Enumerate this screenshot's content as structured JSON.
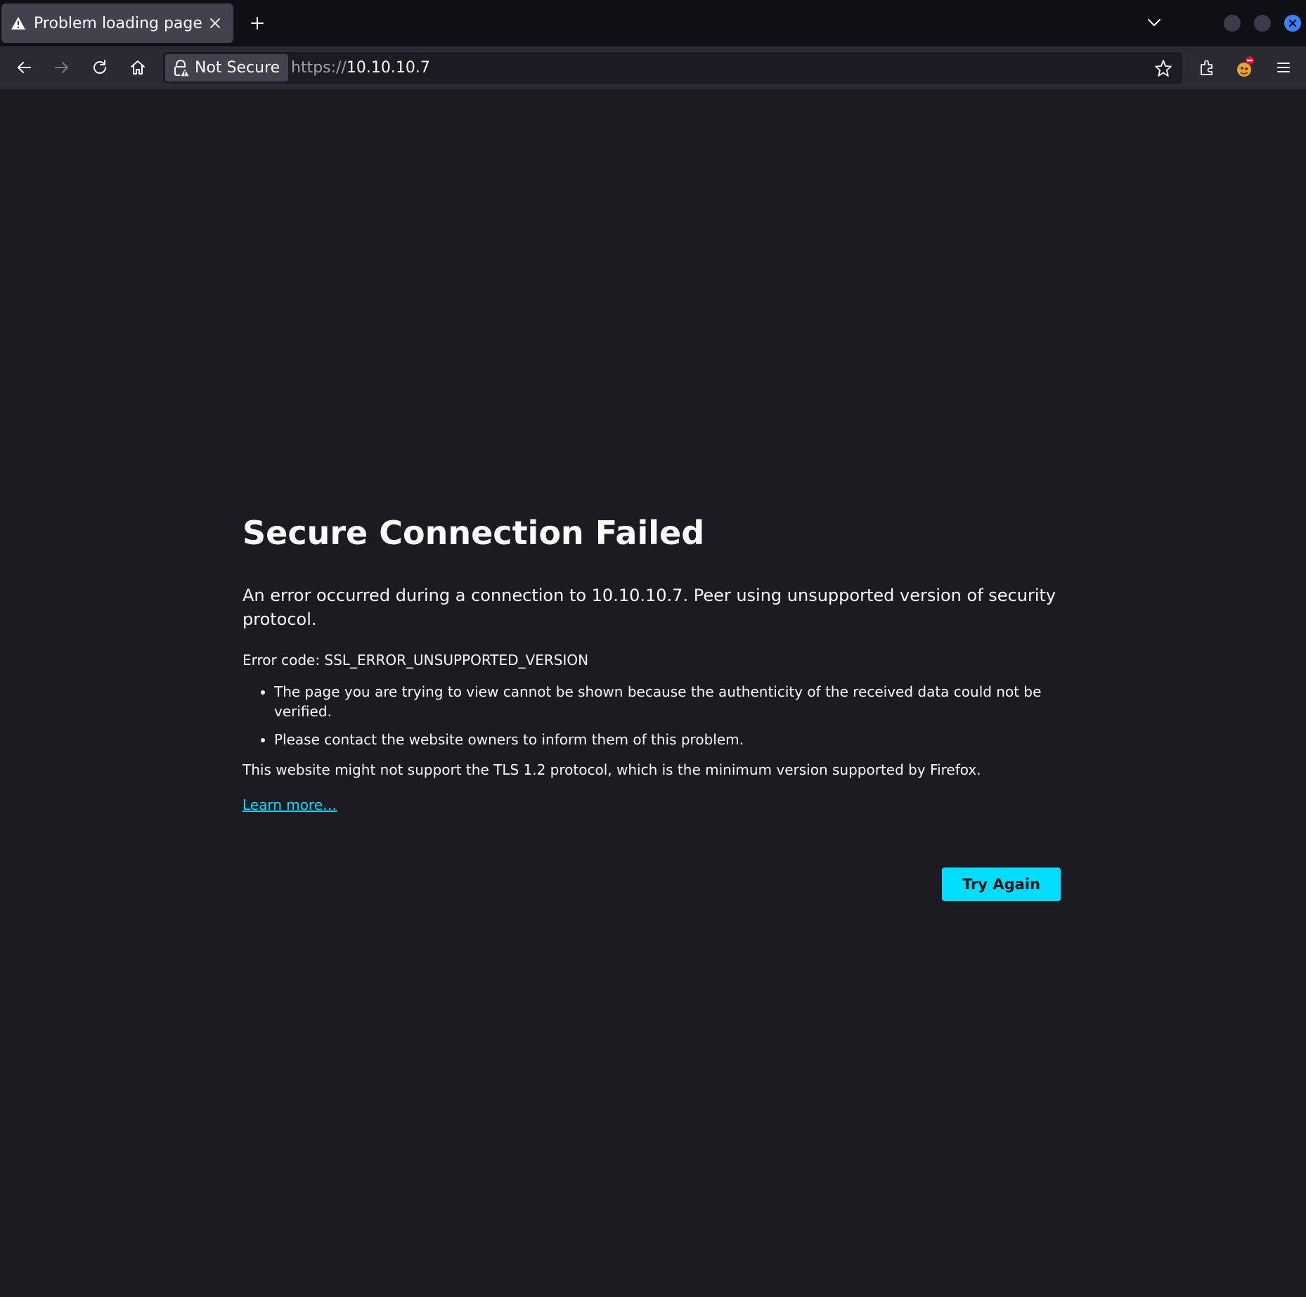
{
  "tab": {
    "title": "Problem loading page",
    "icon": "warning-icon"
  },
  "urlbar": {
    "identity_label": "Not Secure",
    "url_scheme": "https://",
    "url_host": "10.10.10.7"
  },
  "error": {
    "title": "Secure Connection Failed",
    "intro": "An error occurred during a connection to 10.10.10.7. Peer using unsupported version of security protocol.",
    "code_label": "Error code: SSL_ERROR_UNSUPPORTED_VERSION",
    "bullets": [
      "The page you are trying to view cannot be shown because the authenticity of the received data could not be verified.",
      "Please contact the website owners to inform them of this problem."
    ],
    "tls_note": "This website might not support the TLS 1.2 protocol, which is the minimum version supported by Firefox.",
    "learn_more": "Learn more…",
    "try_again": "Try Again"
  },
  "colors": {
    "page_bg": "#1c1b22",
    "tabstrip_bg": "#0f0f16",
    "toolbar_bg": "#2b2a33",
    "accent": "#00ddff",
    "window_close": "#3b82f6"
  }
}
